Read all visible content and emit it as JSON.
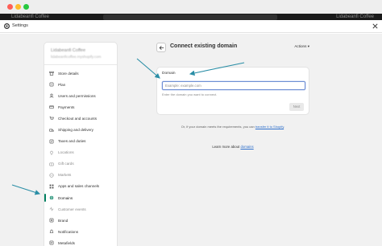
{
  "window": {
    "brand": "Lidabeanfi Coffee",
    "store_menu": "Lidabeanfi Coffee"
  },
  "settings_bar": {
    "title": "Settings"
  },
  "sidebar": {
    "store_name": "Lidabeanfi Coffee",
    "store_url": "lidabeanficoffee.myshopify.com",
    "items": [
      {
        "label": "Store details",
        "icon": "store-icon"
      },
      {
        "label": "Plan",
        "icon": "plan-icon"
      },
      {
        "label": "Users and permissions",
        "icon": "users-icon"
      },
      {
        "label": "Payments",
        "icon": "payments-icon"
      },
      {
        "label": "Checkout and accounts",
        "icon": "checkout-icon"
      },
      {
        "label": "Shipping and delivery",
        "icon": "truck-icon"
      },
      {
        "label": "Taxes and duties",
        "icon": "taxes-icon"
      },
      {
        "label": "Locations",
        "icon": "location-icon"
      },
      {
        "label": "Gift cards",
        "icon": "gift-card-icon"
      },
      {
        "label": "Markets",
        "icon": "globe-icon"
      },
      {
        "label": "Apps and sales channels",
        "icon": "apps-icon"
      },
      {
        "label": "Domains",
        "icon": "domains-icon"
      },
      {
        "label": "Customer events",
        "icon": "customer-events-icon"
      },
      {
        "label": "Brand",
        "icon": "brand-icon"
      },
      {
        "label": "Notifications",
        "icon": "bell-icon"
      },
      {
        "label": "Metafields",
        "icon": "metafields-icon"
      }
    ]
  },
  "header": {
    "title": "Connect existing domain",
    "actions_label": "Actions"
  },
  "card": {
    "label": "Domain",
    "input_placeholder": "Example: example.com",
    "help_text": "Enter the domain you want to connect.",
    "next_label": "Next"
  },
  "footer": {
    "or_text": "Or, if your domain meets the requirements, you can",
    "or_link": "transfer it to Shopify",
    "or_end": ".",
    "learn_text": "Learn more about",
    "learn_link": "domains"
  },
  "colors": {
    "accent": "#008060",
    "arrow": "#2a8ea6",
    "link": "#2c6ecb"
  }
}
